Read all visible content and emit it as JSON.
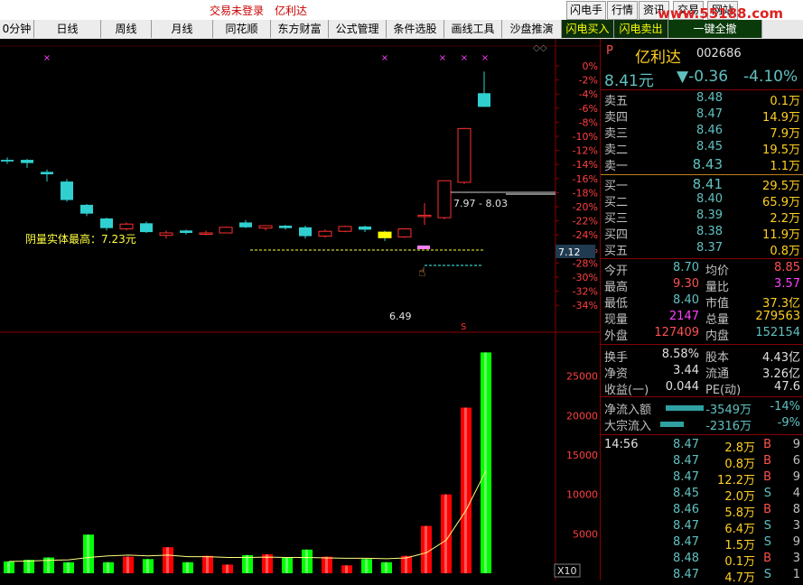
{
  "window": {
    "title": "交易未登录　亿利达",
    "buttons": [
      "闪电手",
      "行情",
      "资讯",
      "交易",
      "网站"
    ],
    "watermark": "www.55188.com"
  },
  "tabs": [
    {
      "label": "0分钟"
    },
    {
      "label": "日线"
    },
    {
      "label": "周线"
    },
    {
      "label": "月线"
    },
    {
      "label": "同花顺"
    },
    {
      "label": "东方财富"
    },
    {
      "label": "公式管理"
    },
    {
      "label": "条件选股"
    },
    {
      "label": "画线工具"
    },
    {
      "label": "沙盘推演"
    },
    {
      "label": "闪电买入"
    },
    {
      "label": "闪电卖出"
    },
    {
      "label": "一键全撤"
    }
  ],
  "chart": {
    "price_axis_labels": [
      "0%",
      "-2%",
      "-4%",
      "-6%",
      "-8%",
      "-10%",
      "-12%",
      "-14%",
      "-16%",
      "-18%",
      "-20%",
      "-22%",
      "-24%",
      "-26%",
      "-28%",
      "-30%",
      "-32%",
      "-34%"
    ],
    "volume_axis_labels": [
      "25000",
      "20000",
      "15000",
      "10000",
      "5000"
    ],
    "annotation_max": "阴量实体最高：7.23元",
    "annotation_low": "6.49",
    "range_label": "7.97 - 8.03",
    "crosshair_price": "7.12",
    "scale_badge": "X10",
    "marker_s": "S",
    "colors": {
      "up": "#ff3030",
      "down": "#30d0d0",
      "vol_up": "#ff0000",
      "vol_down": "#00ff00",
      "ma": "#ffff60"
    },
    "candles": [
      {
        "o": 7.6,
        "c": 7.58,
        "h": 7.63,
        "l": 7.55
      },
      {
        "o": 7.6,
        "c": 7.56,
        "h": 7.61,
        "l": 7.5
      },
      {
        "o": 7.45,
        "c": 7.42,
        "h": 7.48,
        "l": 7.33
      },
      {
        "o": 7.33,
        "c": 7.1,
        "h": 7.36,
        "l": 7.08
      },
      {
        "o": 7.04,
        "c": 6.93,
        "h": 7.05,
        "l": 6.9
      },
      {
        "o": 6.87,
        "c": 6.75,
        "h": 6.88,
        "l": 6.72
      },
      {
        "o": 6.74,
        "c": 6.8,
        "h": 6.82,
        "l": 6.72
      },
      {
        "o": 6.81,
        "c": 6.7,
        "h": 6.83,
        "l": 6.69
      },
      {
        "o": 6.66,
        "c": 6.69,
        "h": 6.72,
        "l": 6.62
      },
      {
        "o": 6.72,
        "c": 6.69,
        "h": 6.73,
        "l": 6.67
      },
      {
        "o": 6.69,
        "c": 6.69,
        "h": 6.72,
        "l": 6.66
      },
      {
        "o": 6.69,
        "c": 6.76,
        "h": 6.77,
        "l": 6.69
      },
      {
        "o": 6.82,
        "c": 6.76,
        "h": 6.85,
        "l": 6.75
      },
      {
        "o": 6.75,
        "c": 6.78,
        "h": 6.78,
        "l": 6.72
      },
      {
        "o": 6.78,
        "c": 6.75,
        "h": 6.79,
        "l": 6.73
      },
      {
        "o": 6.76,
        "c": 6.65,
        "h": 6.78,
        "l": 6.62
      },
      {
        "o": 6.65,
        "c": 6.71,
        "h": 6.73,
        "l": 6.63
      },
      {
        "o": 6.71,
        "c": 6.77,
        "h": 6.78,
        "l": 6.7
      },
      {
        "o": 6.77,
        "c": 6.73,
        "h": 6.78,
        "l": 6.7
      },
      {
        "o": 6.7,
        "c": 6.63,
        "h": 6.72,
        "l": 6.59
      },
      {
        "o": 6.64,
        "c": 6.74,
        "h": 6.74,
        "l": 6.63
      },
      {
        "o": 6.9,
        "c": 6.91,
        "h": 7.06,
        "l": 6.79
      },
      {
        "o": 6.88,
        "c": 7.34,
        "h": 7.34,
        "l": 6.86
      },
      {
        "o": 7.32,
        "c": 7.99,
        "h": 8.0,
        "l": 7.3
      },
      {
        "o": 8.43,
        "c": 8.26,
        "h": 8.7,
        "l": 8.26
      }
    ],
    "volumes": [
      1500,
      1700,
      2000,
      1400,
      4900,
      1400,
      2100,
      1800,
      3300,
      1400,
      2200,
      1100,
      2300,
      2400,
      2000,
      3000,
      2100,
      1000,
      1800,
      1400,
      2200,
      6000,
      10000,
      21000,
      28000
    ],
    "ma_volume": [
      1500,
      1550,
      1650,
      1700,
      2000,
      2200,
      2300,
      2200,
      2300,
      2100,
      2100,
      2000,
      2000,
      2050,
      2000,
      2000,
      1950,
      1900,
      1900,
      1850,
      1950,
      2600,
      4200,
      8000,
      13000
    ]
  },
  "stock": {
    "flag": "P",
    "name": "亿利达",
    "code": "002686",
    "price": "8.41元",
    "change": "▼-0.36",
    "change_pct": "-4.10%"
  },
  "order_book": {
    "asks": [
      {
        "label": "卖五",
        "price": "8.48",
        "volume": "0.1万"
      },
      {
        "label": "卖四",
        "price": "8.47",
        "volume": "14.9万"
      },
      {
        "label": "卖三",
        "price": "8.46",
        "volume": "7.9万"
      },
      {
        "label": "卖二",
        "price": "8.45",
        "volume": "19.5万"
      },
      {
        "label": "卖一",
        "price": "8.43",
        "volume": "1.1万"
      }
    ],
    "bids": [
      {
        "label": "买一",
        "price": "8.41",
        "volume": "29.5万"
      },
      {
        "label": "买二",
        "price": "8.40",
        "volume": "65.9万"
      },
      {
        "label": "买三",
        "price": "8.39",
        "volume": "2.2万"
      },
      {
        "label": "买四",
        "price": "8.38",
        "volume": "11.9万"
      },
      {
        "label": "买五",
        "price": "8.37",
        "volume": "0.8万"
      }
    ]
  },
  "quote": [
    {
      "l1": "今开",
      "v1": "8.70",
      "l2": "均价",
      "v2": "8.85"
    },
    {
      "l1": "最高",
      "v1": "9.30",
      "l2": "量比",
      "v2": "3.57"
    },
    {
      "l1": "最低",
      "v1": "8.40",
      "l2": "市值",
      "v2": "37.3亿"
    },
    {
      "l1": "现量",
      "v1": "2147",
      "l2": "总量",
      "v2": "279563"
    },
    {
      "l1": "外盘",
      "v1": "127409",
      "l2": "内盘",
      "v2": "152154"
    }
  ],
  "fundamentals": [
    {
      "l1": "换手",
      "v1": "8.58%",
      "l2": "股本",
      "v2": "4.43亿"
    },
    {
      "l1": "净资",
      "v1": "3.44",
      "l2": "流通",
      "v2": "3.26亿"
    },
    {
      "l1": "收益(一)",
      "v1": "0.044",
      "l2": "PE(动)",
      "v2": "47.6"
    }
  ],
  "flows": [
    {
      "label": "净流入额",
      "value": "-3549万",
      "pct": "-14%"
    },
    {
      "label": "大宗流入",
      "value": "-2316万",
      "pct": "-9%"
    }
  ],
  "ticks": [
    {
      "time": "14:56",
      "price": "8.47",
      "vol": "2.8万",
      "side": "B",
      "num": "9"
    },
    {
      "time": "",
      "price": "8.47",
      "vol": "0.8万",
      "side": "B",
      "num": "6"
    },
    {
      "time": "",
      "price": "8.47",
      "vol": "12.2万",
      "side": "B",
      "num": "9"
    },
    {
      "time": "",
      "price": "8.45",
      "vol": "2.0万",
      "side": "S",
      "num": "4"
    },
    {
      "time": "",
      "price": "8.46",
      "vol": "5.8万",
      "side": "B",
      "num": "8"
    },
    {
      "time": "",
      "price": "8.47",
      "vol": "6.4万",
      "side": "S",
      "num": "3"
    },
    {
      "time": "",
      "price": "8.47",
      "vol": "1.5万",
      "side": "S",
      "num": "9"
    },
    {
      "time": "",
      "price": "8.48",
      "vol": "0.1万",
      "side": "B",
      "num": "3"
    },
    {
      "time": "",
      "price": "8.47",
      "vol": "4.7万",
      "side": "S",
      "num": "1"
    }
  ]
}
